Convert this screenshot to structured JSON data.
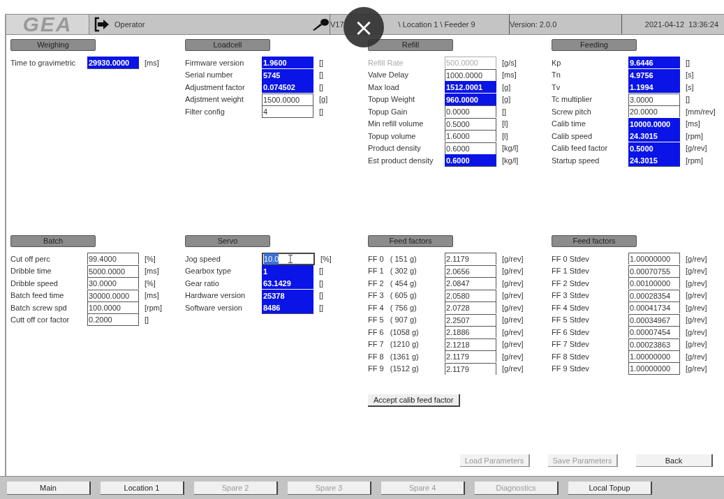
{
  "header": {
    "logo": "GEA",
    "user": "Operator",
    "path_start": "V17",
    "path_end": "\\ Location 1 \\ Feeder 9",
    "version": "Version: 2.0.0",
    "datetime": "2021-04-12  13:36:24"
  },
  "sections": [
    {
      "title": "Weighing",
      "rows": [
        {
          "label": "Time to gravimetric",
          "value": "29930.0000",
          "unit": "[ms]",
          "highlighted": true,
          "disabled": false,
          "editing": false
        }
      ]
    },
    {
      "title": "Loadcell",
      "rows": [
        {
          "label": "Firmware version",
          "value": "1.9600",
          "unit": "[]",
          "highlighted": true,
          "disabled": false,
          "editing": false
        },
        {
          "label": "Serial number",
          "value": "5745",
          "unit": "[]",
          "highlighted": true,
          "disabled": false,
          "editing": false
        },
        {
          "label": "Adjustment factor",
          "value": "0.074502",
          "unit": "[]",
          "highlighted": true,
          "disabled": false,
          "editing": false
        },
        {
          "label": "Adjstment weight",
          "value": "1500.0000",
          "unit": "[g]",
          "highlighted": false,
          "disabled": false,
          "editing": false
        },
        {
          "label": "Filter config",
          "value": "4",
          "unit": "[]",
          "highlighted": false,
          "disabled": false,
          "editing": false
        }
      ]
    },
    {
      "title": "Refill",
      "rows": [
        {
          "label": "Refill Rate",
          "value": "500.0000",
          "unit": "[g/s]",
          "highlighted": false,
          "disabled": true,
          "editing": false
        },
        {
          "label": "Valve Delay",
          "value": "1000.0000",
          "unit": "[ms]",
          "highlighted": false,
          "disabled": false,
          "editing": false
        },
        {
          "label": "Max load",
          "value": "1512.0001",
          "unit": "[g]",
          "highlighted": true,
          "disabled": false,
          "editing": false
        },
        {
          "label": "Topup Weight",
          "value": "960.0000",
          "unit": "[g]",
          "highlighted": true,
          "disabled": false,
          "editing": false
        },
        {
          "label": "Topup Gain",
          "value": "0.0000",
          "unit": "[]",
          "highlighted": false,
          "disabled": false,
          "editing": false
        },
        {
          "label": "Min refill volume",
          "value": "0.5000",
          "unit": "[l]",
          "highlighted": false,
          "disabled": false,
          "editing": false
        },
        {
          "label": "Topup volume",
          "value": "1.6000",
          "unit": "[l]",
          "highlighted": false,
          "disabled": false,
          "editing": false
        },
        {
          "label": "Product density",
          "value": "0.6000",
          "unit": "[kg/l]",
          "highlighted": false,
          "disabled": false,
          "editing": false
        },
        {
          "label": "Est product density",
          "value": "0.6000",
          "unit": "[kg/l]",
          "highlighted": true,
          "disabled": false,
          "editing": false
        }
      ]
    },
    {
      "title": "Feeding",
      "rows": [
        {
          "label": "Kp",
          "value": "9.6446",
          "unit": "[]",
          "highlighted": true,
          "disabled": false,
          "editing": false
        },
        {
          "label": "Tn",
          "value": "4.9756",
          "unit": "[s]",
          "highlighted": true,
          "disabled": false,
          "editing": false
        },
        {
          "label": "Tv",
          "value": "1.1994",
          "unit": "[s]",
          "highlighted": true,
          "disabled": false,
          "editing": false
        },
        {
          "label": "Tc multiplier",
          "value": "3.0000",
          "unit": "[]",
          "highlighted": false,
          "disabled": false,
          "editing": false
        },
        {
          "label": "Screw pitch",
          "value": "20.0000",
          "unit": "[mm/rev]",
          "highlighted": false,
          "disabled": false,
          "editing": false
        },
        {
          "label": "Calib time",
          "value": "10000.0000",
          "unit": "[ms]",
          "highlighted": true,
          "disabled": false,
          "editing": false
        },
        {
          "label": "Calib speed",
          "value": "24.3015",
          "unit": "[rpm]",
          "highlighted": true,
          "disabled": false,
          "editing": false
        },
        {
          "label": "Calib feed factor",
          "value": "0.5000",
          "unit": "[g/rev]",
          "highlighted": true,
          "disabled": false,
          "editing": false
        },
        {
          "label": "Startup speed",
          "value": "24.3015",
          "unit": "[rpm]",
          "highlighted": true,
          "disabled": false,
          "editing": false
        }
      ]
    },
    {
      "title": "Batch",
      "rows": [
        {
          "label": "Cut off perc",
          "value": "99.4000",
          "unit": "[%]",
          "highlighted": false,
          "disabled": false,
          "editing": false
        },
        {
          "label": "Dribble time",
          "value": "5000.0000",
          "unit": "[ms]",
          "highlighted": false,
          "disabled": false,
          "editing": false
        },
        {
          "label": "Dribble speed",
          "value": "30.0000",
          "unit": "[%]",
          "highlighted": false,
          "disabled": false,
          "editing": false
        },
        {
          "label": "Batch feed time",
          "value": "30000.0000",
          "unit": "[ms]",
          "highlighted": false,
          "disabled": false,
          "editing": false
        },
        {
          "label": "Batch screw spd",
          "value": "100.0000",
          "unit": "[rpm]",
          "highlighted": false,
          "disabled": false,
          "editing": false
        },
        {
          "label": "Cutt off cor factor",
          "value": "0.2000",
          "unit": "[]",
          "highlighted": false,
          "disabled": false,
          "editing": false
        }
      ]
    },
    {
      "title": "Servo",
      "rows": [
        {
          "label": "Jog speed",
          "value": "10.0",
          "unit": "[%]",
          "highlighted": false,
          "disabled": false,
          "editing": true
        },
        {
          "label": "Gearbox type",
          "value": "1",
          "unit": "[]",
          "highlighted": true,
          "disabled": false,
          "editing": false
        },
        {
          "label": "Gear ratio",
          "value": "63.1429",
          "unit": "[]",
          "highlighted": true,
          "disabled": false,
          "editing": false
        },
        {
          "label": "Hardware version",
          "value": "25378",
          "unit": "[]",
          "highlighted": true,
          "disabled": false,
          "editing": false
        },
        {
          "label": "Software version",
          "value": "8486",
          "unit": "[]",
          "highlighted": true,
          "disabled": false,
          "editing": false
        }
      ]
    },
    {
      "title": "Feed factors",
      "rows": [
        {
          "label": "FF 0   ( 151 g)",
          "value": "2.1179",
          "unit": "[g/rev]",
          "highlighted": false,
          "disabled": false,
          "editing": false
        },
        {
          "label": "FF 1   ( 302 g)",
          "value": "2.0656",
          "unit": "[g/rev]",
          "highlighted": false,
          "disabled": false,
          "editing": false
        },
        {
          "label": "FF 2   ( 454 g)",
          "value": "2.0847",
          "unit": "[g/rev]",
          "highlighted": false,
          "disabled": false,
          "editing": false
        },
        {
          "label": "FF 3   ( 605 g)",
          "value": "2.0580",
          "unit": "[g/rev]",
          "highlighted": false,
          "disabled": false,
          "editing": false
        },
        {
          "label": "FF 4   ( 756 g)",
          "value": "2.0728",
          "unit": "[g/rev]",
          "highlighted": false,
          "disabled": false,
          "editing": false
        },
        {
          "label": "FF 5   ( 907 g)",
          "value": "2.2507",
          "unit": "[g/rev]",
          "highlighted": false,
          "disabled": false,
          "editing": false
        },
        {
          "label": "FF 6   (1058 g)",
          "value": "2.1886",
          "unit": "[g/rev]",
          "highlighted": false,
          "disabled": false,
          "editing": false
        },
        {
          "label": "FF 7   (1210 g)",
          "value": "2.1218",
          "unit": "[g/rev]",
          "highlighted": false,
          "disabled": false,
          "editing": false
        },
        {
          "label": "FF 8   (1361 g)",
          "value": "2.1179",
          "unit": "[g/rev]",
          "highlighted": false,
          "disabled": false,
          "editing": false
        },
        {
          "label": "FF 9   (1512 g)",
          "value": "2.1179",
          "unit": "[g/rev]",
          "highlighted": false,
          "disabled": false,
          "editing": false
        }
      ],
      "button": {
        "label": "Accept calib feed factor"
      }
    },
    {
      "title": "Feed factors",
      "rows": [
        {
          "label": "FF 0 Stdev",
          "value": "1.00000000",
          "unit": "[g/rev]",
          "highlighted": false,
          "disabled": false,
          "editing": false
        },
        {
          "label": "FF 1 Stdev",
          "value": "0.00070755",
          "unit": "[g/rev]",
          "highlighted": false,
          "disabled": false,
          "editing": false
        },
        {
          "label": "FF 2 Stdev",
          "value": "0.00100000",
          "unit": "[g/rev]",
          "highlighted": false,
          "disabled": false,
          "editing": false
        },
        {
          "label": "FF 3 Stdev",
          "value": "0.00028354",
          "unit": "[g/rev]",
          "highlighted": false,
          "disabled": false,
          "editing": false
        },
        {
          "label": "FF 4 Stdev",
          "value": "0.00041734",
          "unit": "[g/rev]",
          "highlighted": false,
          "disabled": false,
          "editing": false
        },
        {
          "label": "FF 5 Stdev",
          "value": "0.00034967",
          "unit": "[g/rev]",
          "highlighted": false,
          "disabled": false,
          "editing": false
        },
        {
          "label": "FF 6 Stdev",
          "value": "0.00007454",
          "unit": "[g/rev]",
          "highlighted": false,
          "disabled": false,
          "editing": false
        },
        {
          "label": "FF 7 Stdev",
          "value": "0.00023863",
          "unit": "[g/rev]",
          "highlighted": false,
          "disabled": false,
          "editing": false
        },
        {
          "label": "FF 8 Stdev",
          "value": "1.00000000",
          "unit": "[g/rev]",
          "highlighted": false,
          "disabled": false,
          "editing": false
        },
        {
          "label": "FF 9 Stdev",
          "value": "1.00000000",
          "unit": "[g/rev]",
          "highlighted": false,
          "disabled": false,
          "editing": false
        }
      ]
    }
  ],
  "actions": [
    {
      "label": "Load Parameters",
      "disabled": true
    },
    {
      "label": "Save Parameters",
      "disabled": true
    },
    {
      "label": "Back",
      "disabled": false
    }
  ],
  "nav_tabs": [
    {
      "label": "Main",
      "disabled": false
    },
    {
      "label": "Location 1",
      "disabled": false
    },
    {
      "label": "Spare 2",
      "disabled": true
    },
    {
      "label": "Spare 3",
      "disabled": true
    },
    {
      "label": "Spare 4",
      "disabled": true
    },
    {
      "label": "Diagnostics",
      "disabled": true
    },
    {
      "label": "Local Topup",
      "disabled": false
    }
  ],
  "overlay": {
    "close_symbol": "×"
  }
}
